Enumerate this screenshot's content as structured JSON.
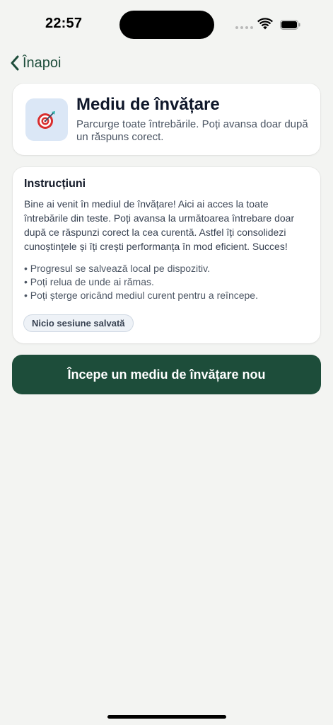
{
  "status_bar": {
    "time": "22:57"
  },
  "nav": {
    "back_label": "Înapoi"
  },
  "header": {
    "icon": "dart-target-icon",
    "title": "Mediu de învățare",
    "subtitle": "Parcurge toate întrebările. Poți avansa doar după un răspuns corect."
  },
  "instructions": {
    "title": "Instrucțiuni",
    "body": "Bine ai venit în mediul de învățare! Aici ai acces la toate întrebările din teste. Poți avansa la următoarea întrebare doar după ce răspunzi corect la cea curentă. Astfel îți consolidezi cunoștințele și îți crești performanța în mod eficient. Succes!",
    "bullets": [
      "Progresul se salvează local pe dispozitiv.",
      "Poți relua de unde ai rămas.",
      "Poți șterge oricând mediul curent pentru a reîncepe."
    ],
    "session_badge": "Nicio sesiune salvată"
  },
  "actions": {
    "start_label": "Începe un mediu de învățare nou"
  },
  "colors": {
    "background": "#f3f4f2",
    "accent": "#1d4d3a",
    "icon_bg": "#dbe7f6"
  }
}
